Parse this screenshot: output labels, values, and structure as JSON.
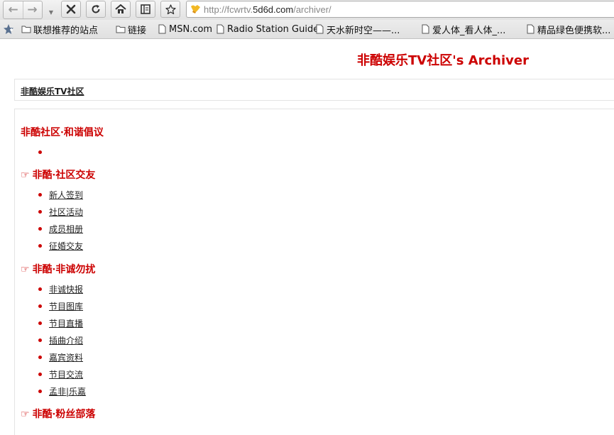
{
  "browser": {
    "url_prefix": "http://fcwrtv.",
    "url_domain": "5d6d.com",
    "url_path": "/archiver/",
    "bookmarks": [
      {
        "label": "联想推荐的站点",
        "icon": "folder-icon"
      },
      {
        "label": "链接",
        "icon": "folder-icon"
      },
      {
        "label": "MSN.com",
        "icon": "page-icon"
      },
      {
        "label": "Radio Station Guide",
        "icon": "page-icon"
      },
      {
        "label": "天水新时空——...",
        "icon": "page-icon"
      },
      {
        "label": "爱人体_看人体_...",
        "icon": "page-icon"
      },
      {
        "label": "精品绿色便携软...",
        "icon": "page-icon"
      }
    ]
  },
  "page": {
    "title": "非酷娱乐TV社区's Archiver",
    "breadcrumb": "非酷娱乐TV社区",
    "sections": [
      {
        "title": "非酷社区·和谐倡议",
        "hand": "",
        "items": [
          ""
        ]
      },
      {
        "title": "非酷·社区交友",
        "hand": "☞",
        "items": [
          "新人签到",
          "社区活动",
          "成员相册",
          "征婚交友"
        ]
      },
      {
        "title": "非酷·非诚勿扰",
        "hand": "☞",
        "items": [
          "非诚快报",
          "节目图库",
          "节目直播",
          "插曲介绍",
          "嘉宾资料",
          "节目交流",
          "孟非|乐嘉"
        ]
      },
      {
        "title": "非酷·粉丝部落",
        "hand": "☞",
        "items": []
      }
    ]
  }
}
